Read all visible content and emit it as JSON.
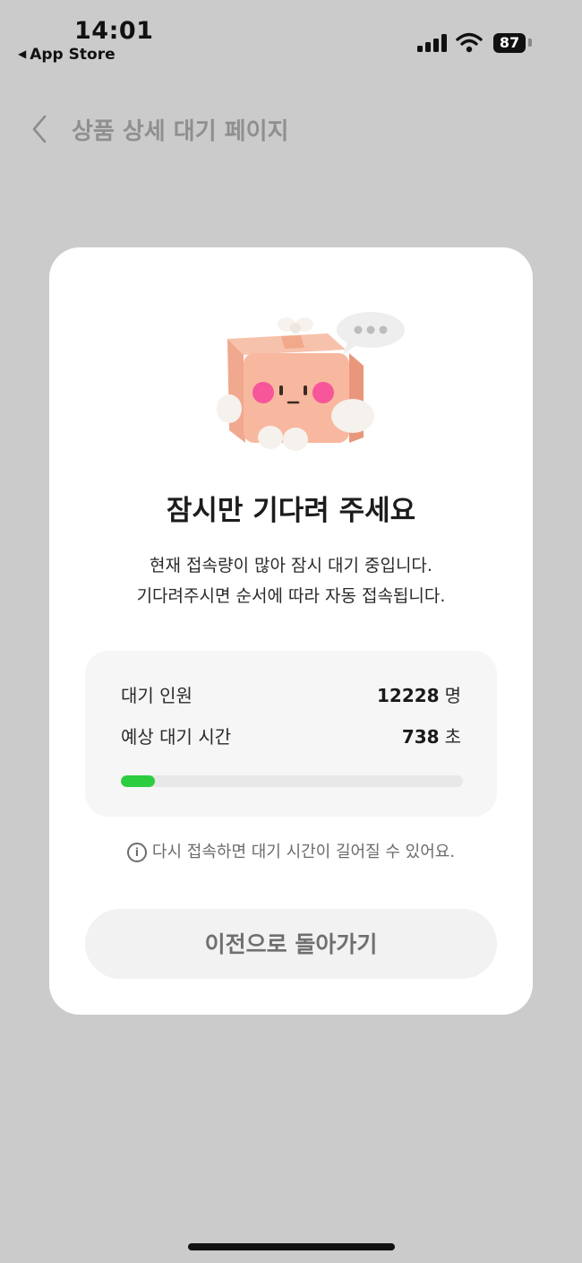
{
  "status_bar": {
    "time": "14:01",
    "back_app": "App Store",
    "battery": "87"
  },
  "header": {
    "title": "상품 상세 대기 페이지"
  },
  "card": {
    "title": "잠시만 기다려 주세요",
    "desc_line1": "현재 접속량이 많아 잠시 대기 중입니다.",
    "desc_line2": "기다려주시면 순서에 따라 자동 접속됩니다.",
    "stats": {
      "queue_label": "대기 인원",
      "queue_value": "12228",
      "queue_unit": "명",
      "wait_label": "예상 대기 시간",
      "wait_value": "738",
      "wait_unit": "초",
      "progress_fraction": 0.1
    },
    "notice": "다시 접속하면 대기 시간이 길어질 수 있어요.",
    "back_button": "이전으로 돌아가기"
  },
  "colors": {
    "background": "#cbcbcb",
    "progress": "#2ecc40",
    "card": "#ffffff"
  }
}
